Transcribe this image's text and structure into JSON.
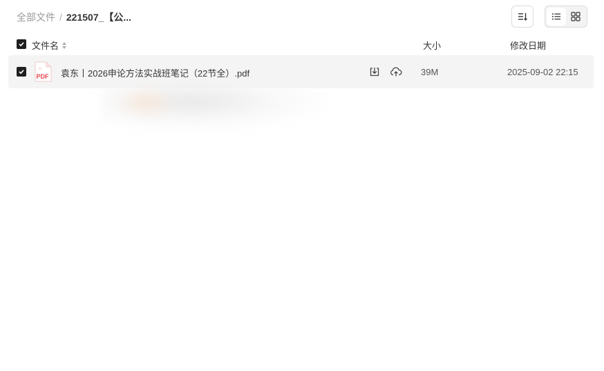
{
  "breadcrumb": {
    "root": "全部文件",
    "separator": "/",
    "current": "221507_【公..."
  },
  "toolbar": {
    "sort_icon": "sort-list-icon",
    "list_view_icon": "list-view-icon",
    "grid_view_icon": "grid-view-icon",
    "active_view": "list"
  },
  "table": {
    "columns": {
      "name": "文件名",
      "size": "大小",
      "date": "修改日期"
    },
    "rows": [
      {
        "icon": "pdf-file-icon",
        "icon_label": "PDF",
        "name": "袁东丨2026申论方法实战班笔记（22节全）.pdf",
        "size": "39M",
        "date": "2025-09-02 22:15",
        "checked": true
      }
    ]
  },
  "colors": {
    "checkbox": "#1f1f1f",
    "row_bg": "#f4f4f4",
    "pdf_red": "#e5484d",
    "muted_text": "#9a9a9a"
  }
}
